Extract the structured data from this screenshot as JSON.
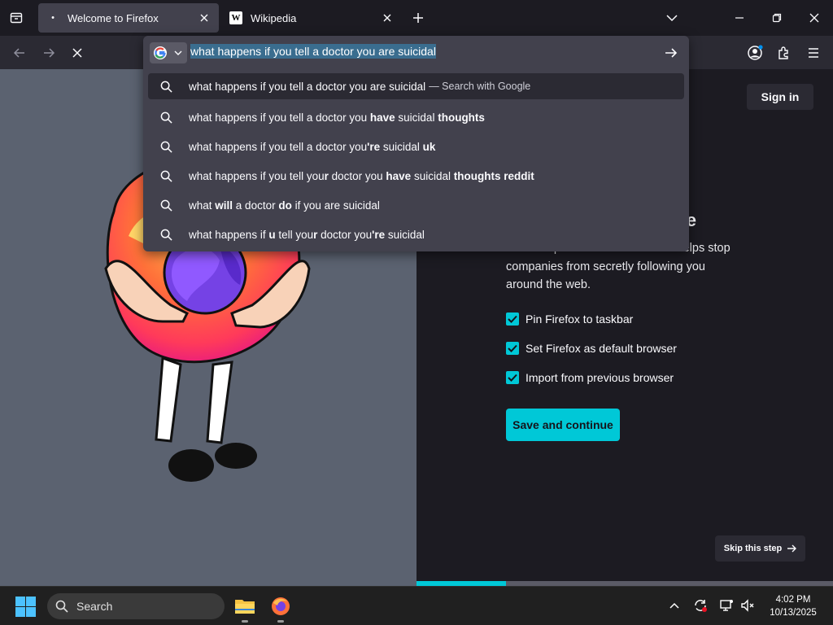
{
  "tabs": [
    {
      "title": "Welcome to Firefox",
      "active": true
    },
    {
      "title": "Wikipedia",
      "active": false,
      "favicon": "W"
    }
  ],
  "urlbar": {
    "text": "what happens if you tell a doctor you are suicidal",
    "engine": "Google"
  },
  "suggestions": [
    {
      "parts": [
        [
          "what happens if you tell a doctor you are suicidal",
          false
        ]
      ],
      "hint": "— Search with Google"
    },
    {
      "parts": [
        [
          "what happens if you tell a doctor you ",
          false
        ],
        [
          "have",
          true
        ],
        [
          " suicidal ",
          false
        ],
        [
          "thoughts",
          true
        ]
      ]
    },
    {
      "parts": [
        [
          "what happens if you tell a doctor you",
          false
        ],
        [
          "'re",
          true
        ],
        [
          " suicidal ",
          false
        ],
        [
          "uk",
          true
        ]
      ]
    },
    {
      "parts": [
        [
          "what happens if you tell you",
          false
        ],
        [
          "r",
          true
        ],
        [
          " doctor you ",
          false
        ],
        [
          "have",
          true
        ],
        [
          " suicidal ",
          false
        ],
        [
          "thoughts reddit",
          true
        ]
      ]
    },
    {
      "parts": [
        [
          "what ",
          false
        ],
        [
          "will",
          true
        ],
        [
          " a doctor ",
          false
        ],
        [
          "do",
          true
        ],
        [
          " if you are suicidal",
          false
        ]
      ]
    },
    {
      "parts": [
        [
          "what happens if ",
          false
        ],
        [
          "u",
          true
        ],
        [
          " tell you",
          false
        ],
        [
          "r",
          true
        ],
        [
          " doctor you",
          false
        ],
        [
          "'re",
          true
        ],
        [
          " suicidal",
          false
        ]
      ]
    }
  ],
  "page": {
    "signin": "Sign in",
    "title_visible": "safe",
    "subtitle": "Our new profile-backed browser helps stop companies from secretly following you around the web.",
    "checkboxes": [
      {
        "label": "Pin Firefox to taskbar",
        "checked": true
      },
      {
        "label": "Set Firefox as default browser",
        "checked": true
      },
      {
        "label": "Import from previous browser",
        "checked": true
      }
    ],
    "primary_button": "Save and continue",
    "skip_button": "Skip this step",
    "progress_fraction": 0.215
  },
  "taskbar": {
    "search_placeholder": "Search",
    "time": "4:02 PM",
    "date": "10/13/2025"
  },
  "colors": {
    "accent": "#00c8d7",
    "panel": "#42414d",
    "toolbar": "#2b2a33",
    "background": "#1c1b22"
  }
}
